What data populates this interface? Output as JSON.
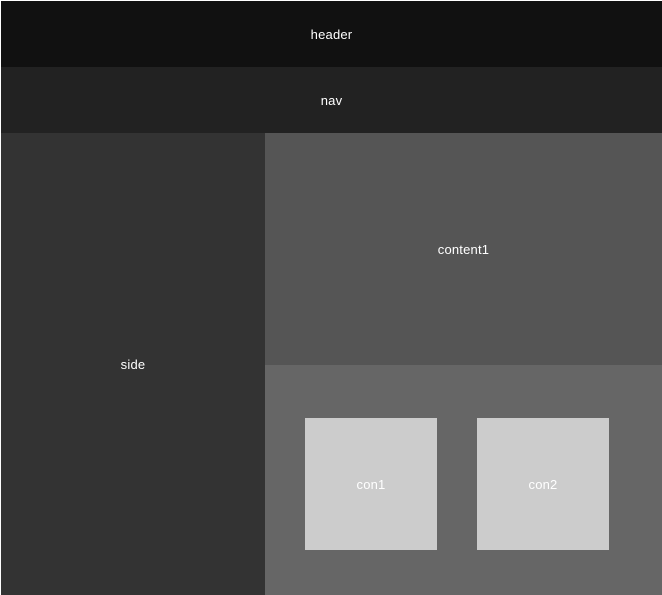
{
  "layout_demo": {
    "header_label": "header",
    "nav_label": "nav",
    "side_label": "side",
    "content1_label": "content1",
    "con1_label": "con1",
    "con2_label": "con2"
  },
  "colors": {
    "header_bg": "#111111",
    "nav_bg": "#222222",
    "side_bg": "#333333",
    "content1_bg": "#555555",
    "content2_bg": "#666666",
    "card_bg": "#cccccc",
    "text": "#ffffff"
  }
}
